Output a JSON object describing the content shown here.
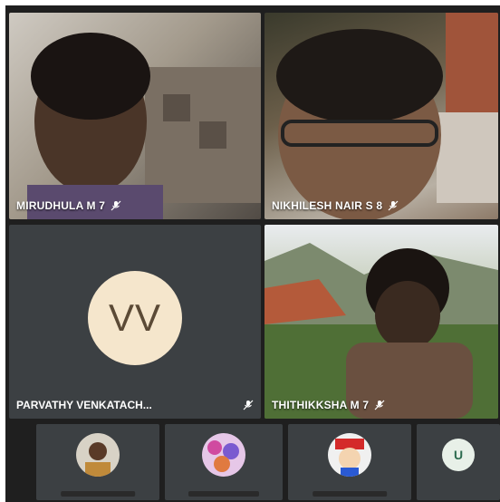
{
  "participants": [
    {
      "name": "MIRUDHULA M 7",
      "mic": "mic-off-icon"
    },
    {
      "name": "NIKHILESH NAIR S 8",
      "mic": "mic-off-icon"
    },
    {
      "name": "PARVATHY VENKATACH...",
      "mic": "mic-off-icon",
      "initials": "VV",
      "avatar_color": "#f5e6cc"
    },
    {
      "name": "THITHIKKSHA M 7",
      "mic": "mic-off-icon"
    }
  ],
  "thumbnails": [
    {
      "type": "photo",
      "icon": "person-photo-avatar"
    },
    {
      "type": "photo",
      "icon": "flowers-avatar"
    },
    {
      "type": "photo",
      "icon": "cartoon-avatar"
    },
    {
      "type": "letter",
      "initial": "U",
      "color": "#e8f0e8"
    }
  ]
}
